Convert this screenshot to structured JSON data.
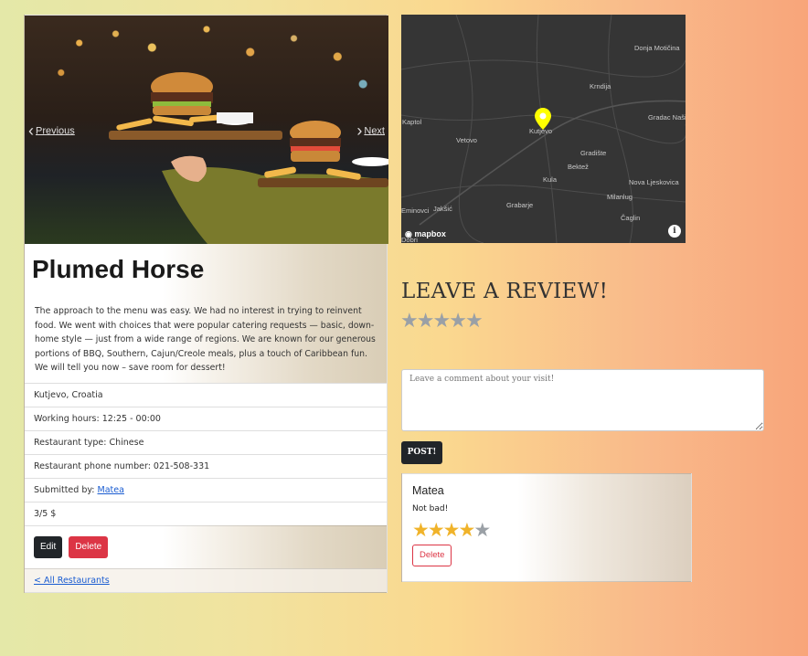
{
  "carousel": {
    "prev_label": "Previous",
    "next_label": "Next"
  },
  "restaurant": {
    "name": "Plumed Horse",
    "description": "The approach to the menu was easy. We had no interest in trying to reinvent food. We went with choices that were popular catering requests — basic, down-home style — just from a wide range of regions. We are known for our generous portions of BBQ, Southern, Cajun/Creole meals, plus a touch of Caribbean fun. We will tell you now – save room for dessert!",
    "location": "Kutjevo, Croatia",
    "working_hours": "Working hours: 12:25 - 00:00",
    "type": "Restaurant type: Chinese",
    "phone": "Restaurant phone number: 021-508-331",
    "submitted_prefix": "Submitted by: ",
    "submitted_by": "Matea",
    "price": "3/5 $"
  },
  "actions": {
    "edit_label": "Edit",
    "delete_label": "Delete",
    "back_link": "< All Restaurants"
  },
  "map": {
    "labels": [
      "Donja Motičina",
      "Krndija",
      "Kaptol",
      "Kutjevo",
      "Gradac Našic",
      "Vetovo",
      "Gradište",
      "Bektež",
      "Kula",
      "Nova Ljeskovica",
      "Milanlug",
      "Eminovci",
      "Jakšić",
      "Grabarje",
      "Čaglin",
      "Dobri"
    ],
    "brand": "mapbox",
    "marker_color": "#ffff00"
  },
  "review_form": {
    "heading": "LEAVE A REVIEW!",
    "comment_placeholder": "Leave a comment about your visit!",
    "post_label": "POST!",
    "rating": 0
  },
  "reviews": [
    {
      "author": "Matea",
      "text": "Not bad!",
      "rating": 4,
      "max_rating": 5,
      "delete_label": "Delete"
    }
  ],
  "colors": {
    "star_on": "#f0b32a",
    "star_off": "#9aa0a6",
    "danger": "#dc3545",
    "dark": "#212529",
    "link": "#1a5cd1"
  }
}
